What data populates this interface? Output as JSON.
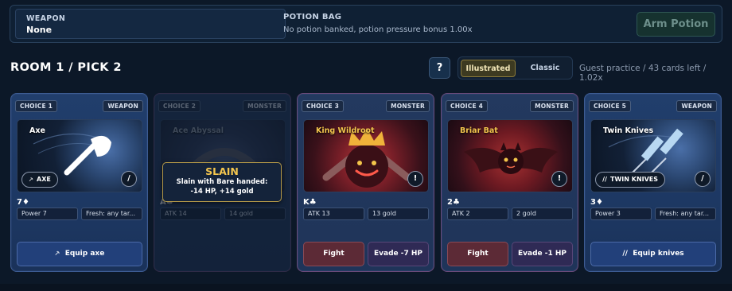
{
  "topbar": {
    "weapon_label": "WEAPON",
    "weapon_value": "None",
    "potion_title": "POTION BAG",
    "potion_text": "No potion banked, potion pressure bonus 1.00x",
    "arm_button": "Arm Potion"
  },
  "header": {
    "room_title": "ROOM 1 / PICK 2",
    "help_label": "?",
    "view_options": [
      "Illustrated",
      "Classic"
    ],
    "selected_view": "Illustrated",
    "guest_text": "Guest practice / 43 cards left / 1.02x"
  },
  "cards": [
    {
      "choice": "CHOICE 1",
      "kind": "WEAPON",
      "name": "Axe",
      "rank": "7♦",
      "chip_icon": "axe-icon",
      "chip_label": "AXE",
      "corner": "/",
      "stats": [
        "Power 7",
        "Fresh: any tar..."
      ],
      "action": "Equip axe",
      "action_icon": "axe-icon"
    },
    {
      "choice": "CHOICE 2",
      "kind": "MONSTER",
      "name": "Ace Abyssal",
      "rank": "A♣",
      "stats": [
        "ATK 14",
        "14 gold"
      ],
      "faded": true
    },
    {
      "choice": "CHOICE 3",
      "kind": "MONSTER",
      "name": "King Wildroot",
      "rank": "K♣",
      "corner": "!",
      "stats": [
        "ATK 13",
        "13 gold"
      ],
      "actions": [
        "Fight",
        "Evade -7 HP"
      ]
    },
    {
      "choice": "CHOICE 4",
      "kind": "MONSTER",
      "name": "Briar Bat",
      "rank": "2♣",
      "corner": "!",
      "stats": [
        "ATK 2",
        "2 gold"
      ],
      "actions": [
        "Fight",
        "Evade -1 HP"
      ]
    },
    {
      "choice": "CHOICE 5",
      "kind": "WEAPON",
      "name": "Twin Knives",
      "rank": "3♦",
      "chip_icon": "twin-knives-icon",
      "chip_label": "TWIN KNIVES",
      "corner": "/",
      "stats": [
        "Power 3",
        "Fresh: any tar..."
      ],
      "action": "Equip knives",
      "action_icon": "twin-knives-icon"
    }
  ],
  "slain_popup": {
    "title": "SLAIN",
    "line1": "Slain with Bare handed:",
    "line2": "-14 HP, +14 gold"
  },
  "colors": {
    "background": "#0c1828",
    "card_blue": "#213e6c",
    "gold_accent": "#f4c64e",
    "fight_red": "#5c2a36",
    "evade_purple": "#2f2a55"
  }
}
